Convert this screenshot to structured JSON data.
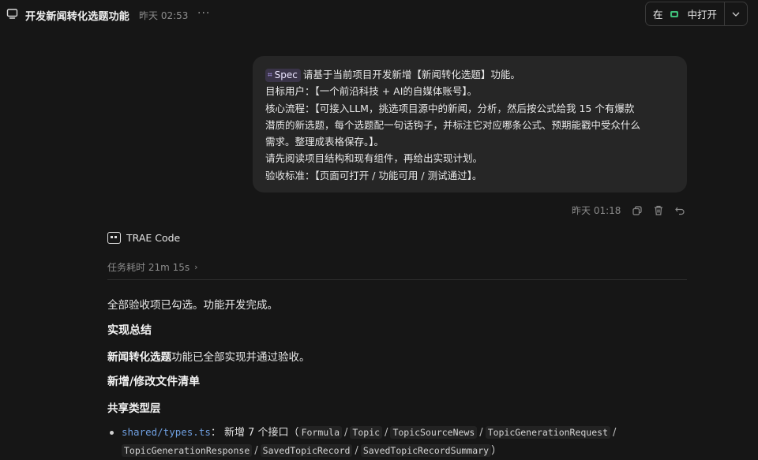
{
  "header": {
    "title": "开发新闻转化选题功能",
    "time": "昨天 02:53",
    "more": "···",
    "open_label_a": "在",
    "open_label_b": "中打开"
  },
  "user_message": {
    "tag": "Spec",
    "line1": "请基于当前项目开发新增【新闻转化选题】功能。",
    "line2": "目标用户：【一个前沿科技 + AI的自媒体账号】。",
    "line3": "核心流程：【可接入LLM，挑选项目源中的新闻，分析，然后按公式给我 15 个有爆款",
    "line4": "潜质的新选题，每个选题配一句话钩子，并标注它对应哪条公式、预期能戳中受众什么",
    "line5": "需求。整理成表格保存。】。",
    "line6": "请先阅读项目结构和现有组件，再给出实现计划。",
    "line7": "验收标准：【页面可打开 / 功能可用 / 测试通过】。",
    "time": "昨天 01:18"
  },
  "assistant": {
    "name": "TRAE Code",
    "duration": "任务耗时 21m 15s",
    "p1": "全部验收项已勾选。功能开发完成。",
    "h1": "实现总结",
    "p2_bold": "新闻转化选题",
    "p2_rest": "功能已全部实现并通过验收。",
    "h2": "新增/修改文件清单",
    "h3": "共享类型层",
    "bullet": {
      "file": "shared/types.ts",
      "text": "： 新增 7 个接口（",
      "types": [
        "Formula",
        "Topic",
        "TopicSourceNews",
        "TopicGenerationRequest",
        "TopicGenerationResponse",
        "SavedTopicRecord",
        "SavedTopicRecordSummary"
      ],
      "close": "）"
    }
  },
  "colors": {
    "background": "#161616",
    "bubble": "#262626",
    "link": "#6f9fe0",
    "spec_tag": "#3a3448",
    "app_chip": "#3fc07a"
  }
}
